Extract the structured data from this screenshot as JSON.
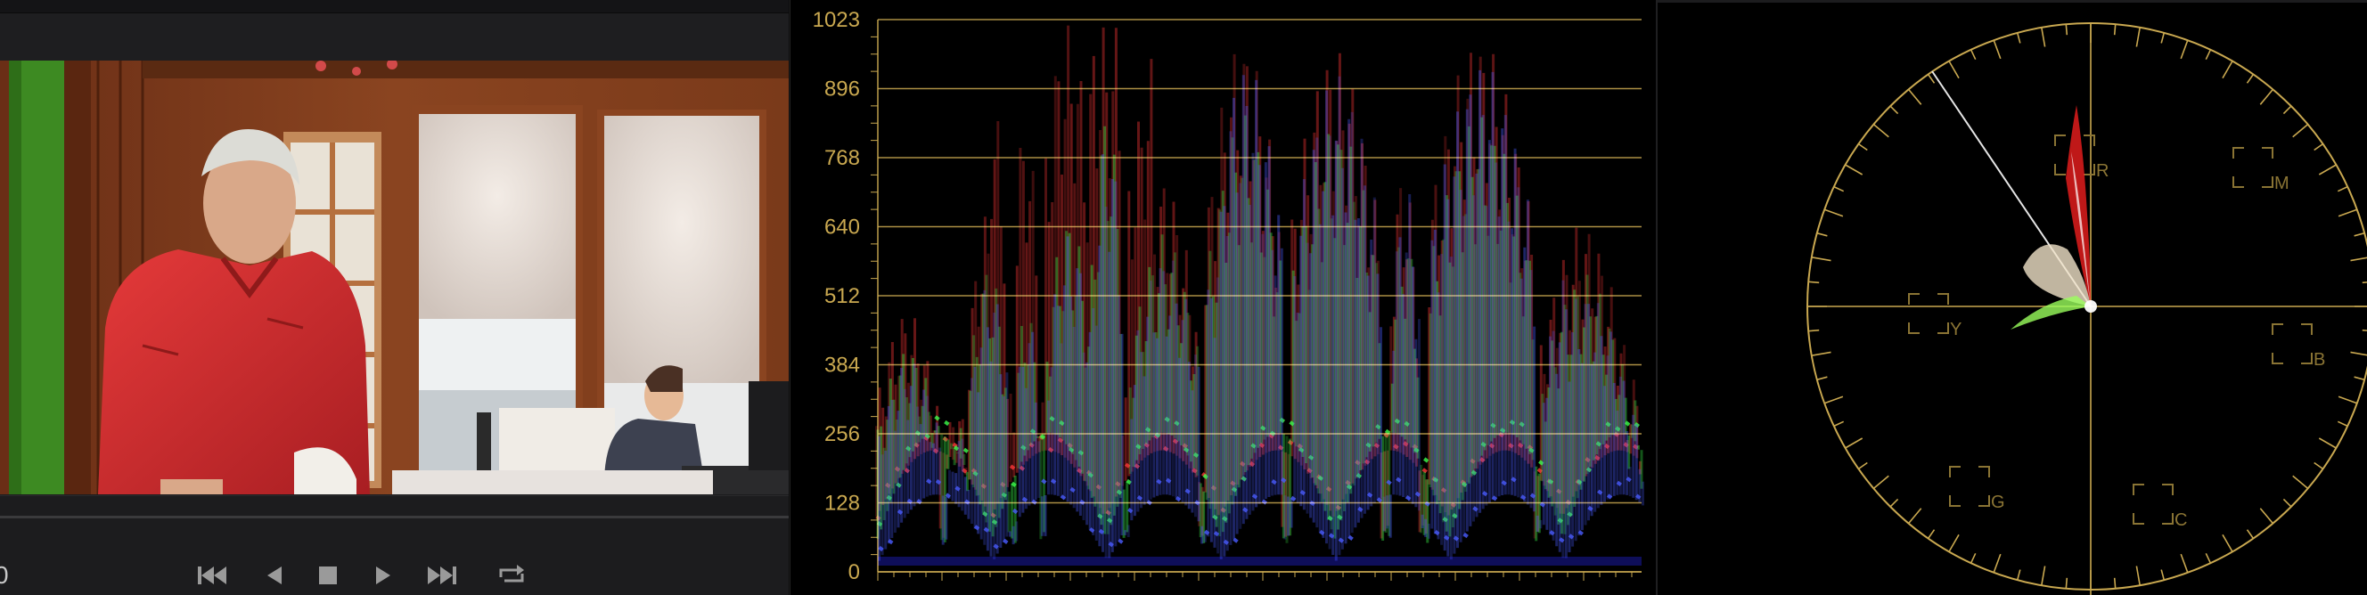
{
  "viewer": {
    "timecode_fragment": "0",
    "transport": {
      "jump_start": "skip-back-icon",
      "step_back": "play-reverse-icon",
      "stop": "stop-icon",
      "play": "play-icon",
      "jump_end": "skip-forward-icon",
      "loop": "loop-icon"
    }
  },
  "waveform": {
    "scale_labels": [
      "1023",
      "896",
      "768",
      "640",
      "512",
      "384",
      "256",
      "128",
      "0"
    ],
    "graticule_color": "#c9a850",
    "trace_colors": {
      "red": "#ff3838",
      "green": "#3cff4c",
      "blue": "#4a5cff"
    }
  },
  "vectorscope": {
    "targets": [
      {
        "label": "R"
      },
      {
        "label": "M"
      },
      {
        "label": "Y"
      },
      {
        "label": "B"
      },
      {
        "label": "G"
      },
      {
        "label": "C"
      }
    ],
    "graticule_color": "#c9a850"
  }
}
